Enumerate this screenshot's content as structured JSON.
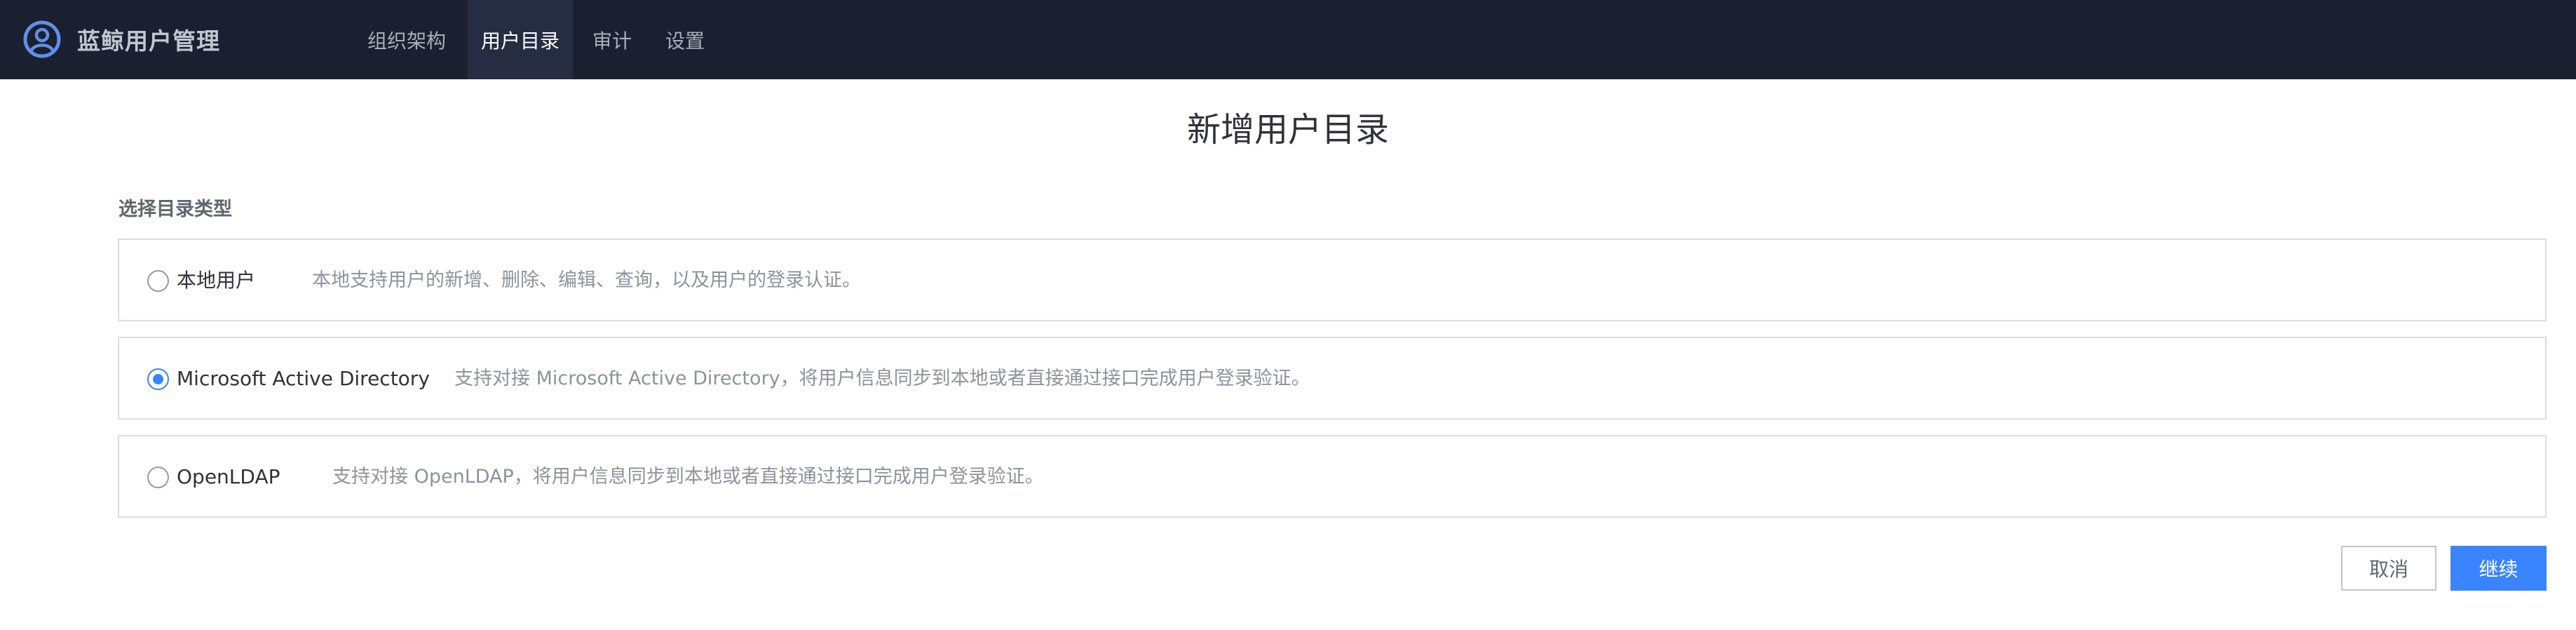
{
  "app": {
    "title": "蓝鲸用户管理",
    "logo_icon": "user-circle-icon"
  },
  "nav": {
    "items": [
      {
        "label": "组织架构",
        "active": false
      },
      {
        "label": "用户目录",
        "active": true
      },
      {
        "label": "审计",
        "active": false
      },
      {
        "label": "设置",
        "active": false
      }
    ]
  },
  "page": {
    "title": "新增用户目录",
    "section_label": "选择目录类型"
  },
  "options": [
    {
      "name": "本地用户",
      "description": "本地支持用户的新增、删除、编辑、查询，以及用户的登录认证。",
      "selected": false
    },
    {
      "name": "Microsoft Active Directory",
      "description": "支持对接 Microsoft Active Directory，将用户信息同步到本地或者直接通过接口完成用户登录验证。",
      "selected": true
    },
    {
      "name": "OpenLDAP",
      "description": "支持对接 OpenLDAP，将用户信息同步到本地或者直接通过接口完成用户登录验证。",
      "selected": false
    }
  ],
  "actions": {
    "cancel_label": "取消",
    "continue_label": "继续"
  },
  "colors": {
    "topbar_bg": "#1b2030",
    "nav_active_bg": "#262d42",
    "primary": "#3a84ff",
    "border": "#dcdee5"
  }
}
